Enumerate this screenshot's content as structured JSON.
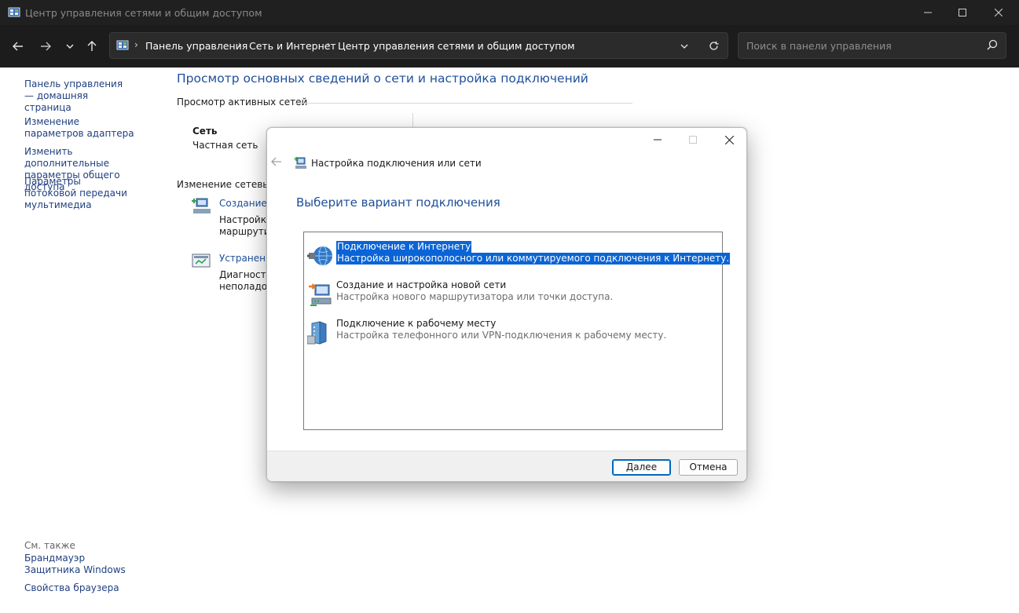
{
  "window": {
    "title": "Центр управления сетями и общим доступом"
  },
  "address_bar": {
    "breadcrumbs": [
      "Панель управления",
      "Сеть и Интернет",
      "Центр управления сетями и общим доступом"
    ],
    "search_placeholder": "Поиск в панели управления"
  },
  "left_pane": {
    "links": [
      "Панель управления — домашняя страница",
      "Изменение параметров адаптера",
      "Изменить дополнительные параметры общего доступа",
      "Параметры потоковой передачи мультимедиа"
    ],
    "see_also_label": "См. также",
    "see_also_links": [
      "Брандмауэр Защитника Windows",
      "Свойства браузера"
    ]
  },
  "main": {
    "heading": "Просмотр основных сведений о сети и настройка подключений",
    "active_networks_label": "Просмотр активных сетей",
    "network_name": "Сеть",
    "network_type": "Частная сеть",
    "change_settings_label": "Изменение сетевых п",
    "item1_link": "Создание и",
    "item1_desc_line1": "Настройка",
    "item1_desc_line2": "маршрутиз",
    "item2_link": "Устранение",
    "item2_desc_line1": "Диагностик",
    "item2_desc_line2": "неполадок"
  },
  "dialog": {
    "title": "Настройка подключения или сети",
    "heading": "Выберите вариант подключения",
    "options": [
      {
        "title": "Подключение к Интернету",
        "desc": "Настройка широкополосного или коммутируемого подключения к Интернету."
      },
      {
        "title": "Создание и настройка новой сети",
        "desc": "Настройка нового маршрутизатора или точки доступа."
      },
      {
        "title": "Подключение к рабочему месту",
        "desc": "Настройка телефонного или VPN-подключения к рабочему месту."
      }
    ],
    "next_button": "Далее",
    "cancel_button": "Отмена"
  },
  "colors": {
    "link": "#1e4f9c",
    "selection": "#0a64d6",
    "chrome_dark": "#202020"
  }
}
